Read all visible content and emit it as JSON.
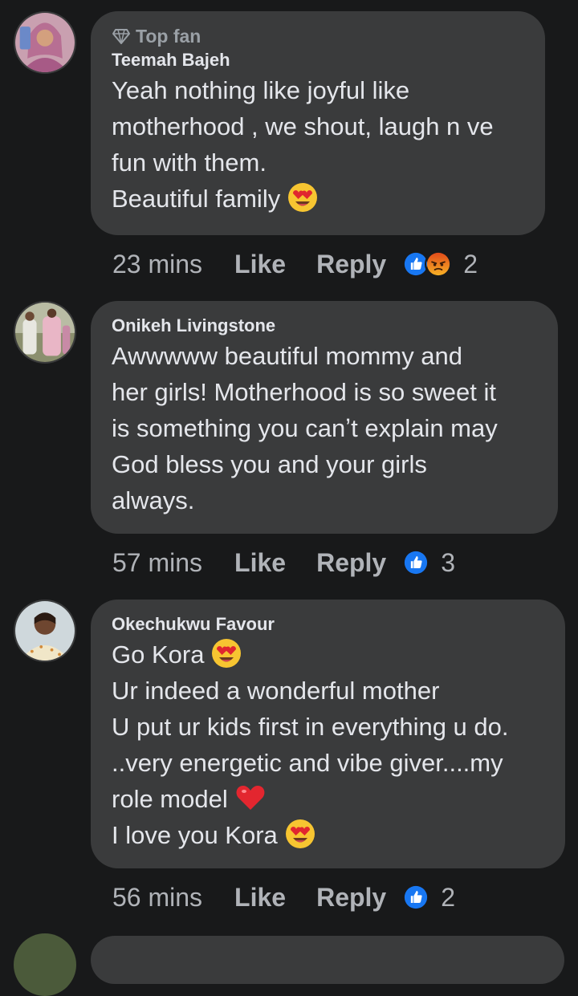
{
  "comments": [
    {
      "badge": "Top fan",
      "author": "Teemah Bajeh",
      "lines": [
        "Yeah nothing like joyful like",
        "motherhood , we shout, laugh n ve",
        "fun with them.",
        "Beautiful family"
      ],
      "time": "23 mins",
      "like_label": "Like",
      "reply_label": "Reply",
      "reactions": [
        "like-icon",
        "angry-icon"
      ],
      "reaction_count": "2"
    },
    {
      "author": "Onikeh Livingstone",
      "lines": [
        "Awwwww beautiful mommy and",
        "her girls! Motherhood is so sweet it",
        "is something you canʼt explain may",
        "God bless you and your girls",
        "always."
      ],
      "time": "57 mins",
      "like_label": "Like",
      "reply_label": "Reply",
      "reactions": [
        "like-icon"
      ],
      "reaction_count": "3"
    },
    {
      "author": "Okechukwu Favour",
      "lines": [
        "Go Kora",
        "Ur indeed a wonderful mother",
        "U put ur kids first in everything u do.",
        "..very energetic and vibe giver....my",
        "role model",
        "I love you Kora"
      ],
      "time": "56 mins",
      "like_label": "Like",
      "reply_label": "Reply",
      "reactions": [
        "like-icon"
      ],
      "reaction_count": "2"
    }
  ],
  "colors": {
    "background": "#18191a",
    "bubble": "#3a3b3c",
    "text": "#e4e6eb",
    "secondary_text": "#b0b3b8",
    "like_blue": "#1877f2",
    "angry_orange": "#e9710f"
  }
}
